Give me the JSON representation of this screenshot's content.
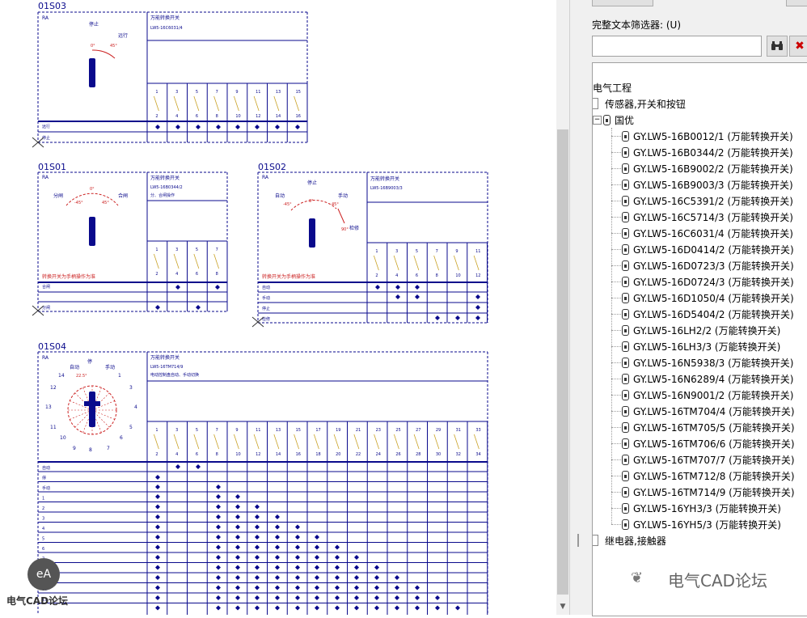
{
  "drawings": {
    "titles": [
      "01S03",
      "01S01",
      "01S02",
      "01S04"
    ],
    "header_text": "万能转换开关",
    "models": [
      "LW5-16C6031/4",
      "LW5-16B0344/2",
      "LW5-16B9003/3",
      "LW5-16TM714/9"
    ],
    "rows_01S03": [
      "远行",
      "停止"
    ],
    "rows_01S01": [
      "合闸",
      "分闸"
    ],
    "rows_01S02": [
      "自动",
      "手动",
      "停止",
      "检修"
    ],
    "rows_01S04": [
      "自动",
      "停",
      "手动",
      "1",
      "2",
      "3",
      "4",
      "5",
      "6",
      "7",
      "8",
      "9",
      "10",
      "11"
    ],
    "note_red": "转换开关为手柄操作为准"
  },
  "panel": {
    "filter_label": "完整文本筛选器: (U)",
    "filter_value": "",
    "tree": {
      "root": "电气工程",
      "category": "传感器,开关和按钮",
      "vendor": "国优",
      "items": [
        "GY.LW5-16B0012/1 (万能转换开关)",
        "GY.LW5-16B0344/2 (万能转换开关)",
        "GY.LW5-16B9002/2 (万能转换开关)",
        "GY.LW5-16B9003/3 (万能转换开关)",
        "GY.LW5-16C5391/2 (万能转换开关)",
        "GY.LW5-16C5714/3 (万能转换开关)",
        "GY.LW5-16C6031/4 (万能转换开关)",
        "GY.LW5-16D0414/2 (万能转换开关)",
        "GY.LW5-16D0723/3 (万能转换开关)",
        "GY.LW5-16D0724/3 (万能转换开关)",
        "GY.LW5-16D1050/4 (万能转换开关)",
        "GY.LW5-16D5404/2 (万能转换开关)",
        "GY.LW5-16LH2/2 (万能转换开关)",
        "GY.LW5-16LH3/3 (万能转换开关)",
        "GY.LW5-16N5938/3 (万能转换开关)",
        "GY.LW5-16N6289/4 (万能转换开关)",
        "GY.LW5-16N9001/2 (万能转换开关)",
        "GY.LW5-16TM704/4 (万能转换开关)",
        "GY.LW5-16TM705/5 (万能转换开关)",
        "GY.LW5-16TM706/6 (万能转换开关)",
        "GY.LW5-16TM707/7 (万能转换开关)",
        "GY.LW5-16TM712/8 (万能转换开关)",
        "GY.LW5-16TM714/9 (万能转换开关)",
        "GY.LW5-16YH3/3 (万能转换开关)",
        "GY.LW5-16YH5/3 (万能转换开关)"
      ],
      "next_category": "继电器,接触器"
    }
  },
  "watermark": {
    "right_text": "电气CAD论坛",
    "left_text": "电气CAD论坛",
    "logo_text": "eA"
  },
  "colors": {
    "drawing_blue": "#0a0a8c",
    "note_red": "#cc2222",
    "delete_red": "#cc0000"
  }
}
